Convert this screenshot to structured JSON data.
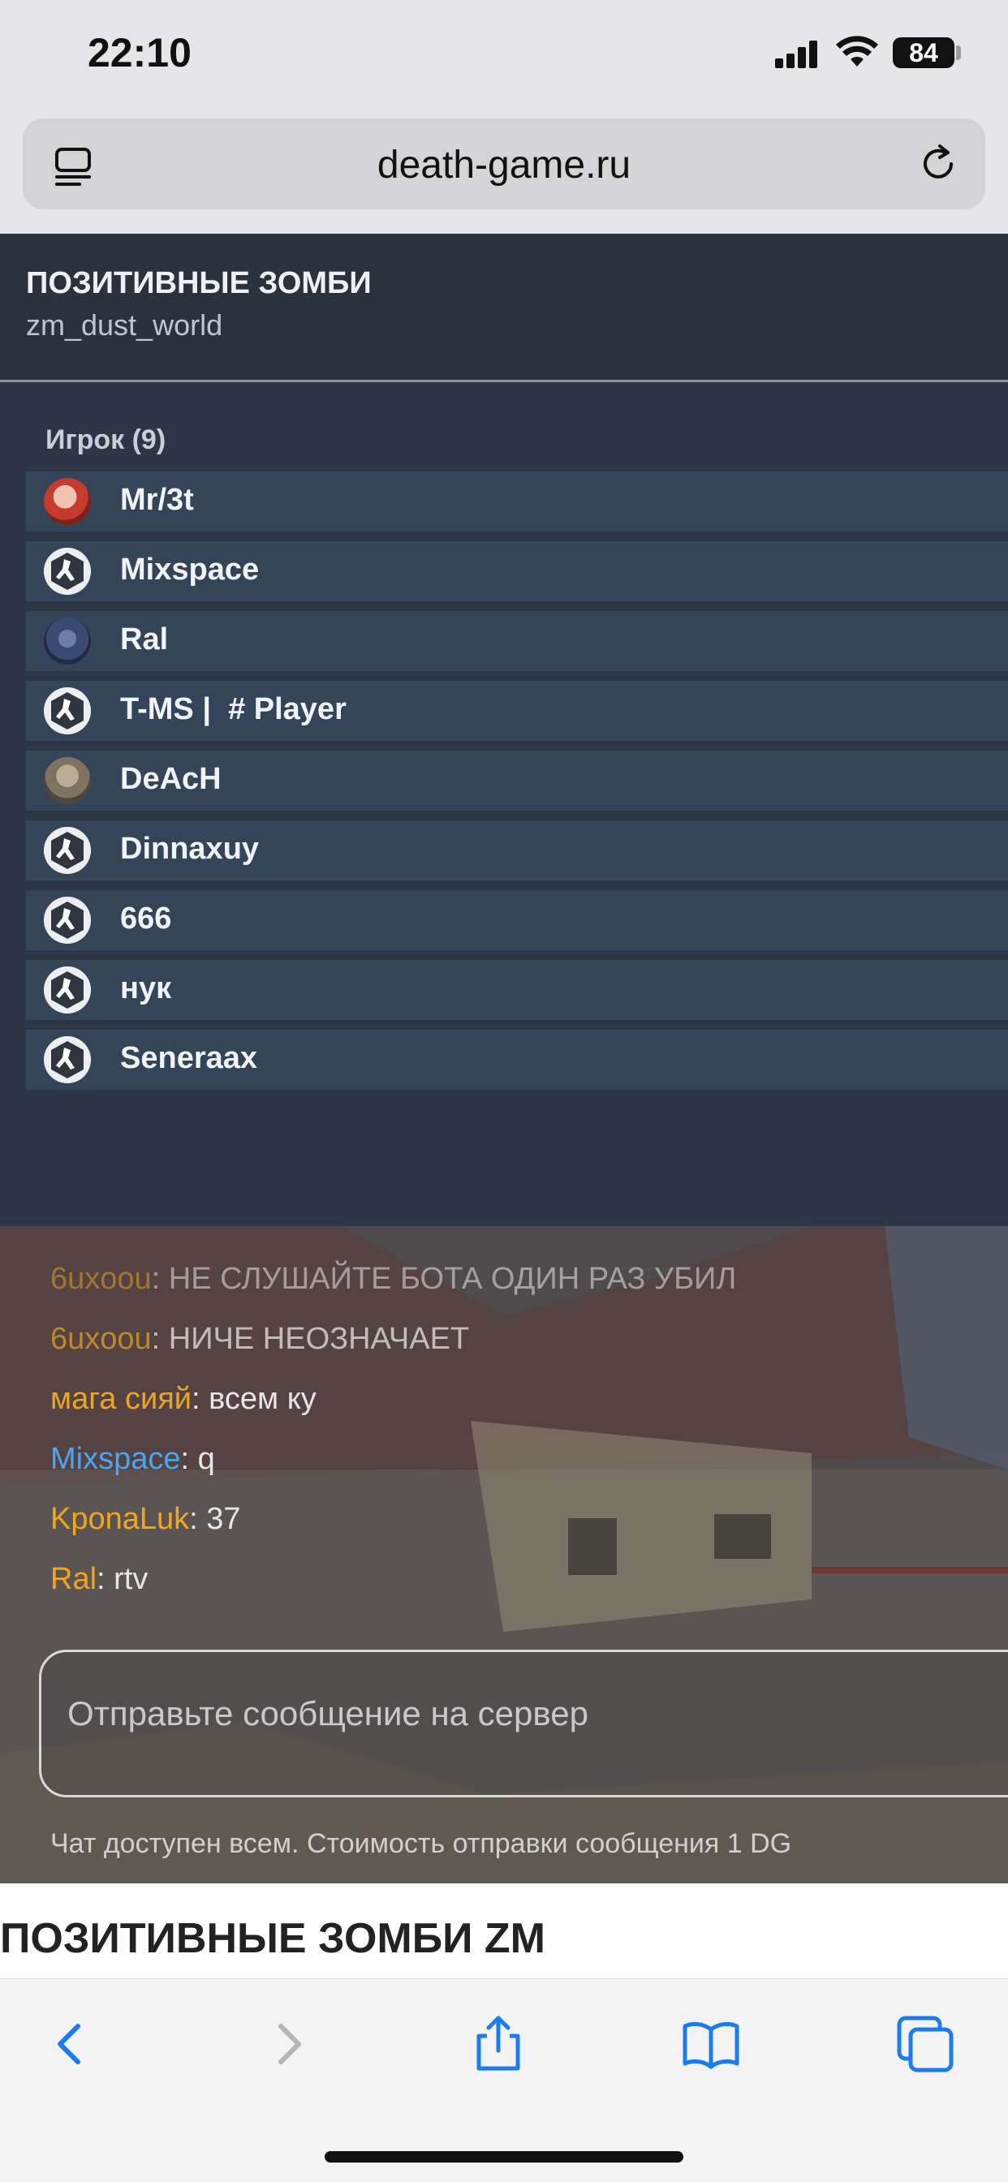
{
  "status_bar": {
    "time": "22:10",
    "battery": "84"
  },
  "browser": {
    "url": "death-game.ru"
  },
  "server": {
    "name": "ПОЗИТИВНЫЕ ЗОМБИ",
    "map": "zm_dust_world"
  },
  "players": {
    "title": "Игрок (9)",
    "items": [
      {
        "name": "Mr/3t",
        "avatar": "photo-avatar"
      },
      {
        "name": "Mixspace",
        "avatar": "cs-logo-avatar"
      },
      {
        "name": "Ral",
        "avatar": "photo-avatar"
      },
      {
        "name": "T-MS |  # Player",
        "avatar": "cs-logo-avatar"
      },
      {
        "name": "DeAcH",
        "avatar": "photo-avatar"
      },
      {
        "name": "Dinnaxuy",
        "avatar": "cs-logo-avatar"
      },
      {
        "name": "666",
        "avatar": "cs-logo-avatar"
      },
      {
        "name": "нук",
        "avatar": "cs-logo-avatar"
      },
      {
        "name": "Seneraax",
        "avatar": "cs-logo-avatar"
      }
    ]
  },
  "chat": {
    "messages": [
      {
        "nick": "6uxoou",
        "sep": ": ",
        "text": "НЕ СЛУШАЙТЕ БОТА ОДИН РАЗ УБИЛ",
        "color": "#e0a020"
      },
      {
        "nick": "6uxoou",
        "sep": ": ",
        "text": "НИЧЕ НЕОЗНАЧАЕТ",
        "color": "#e0a020"
      },
      {
        "nick": "мага сияй",
        "sep": ": ",
        "text": "всем ку",
        "color": "#e8a628"
      },
      {
        "nick": "Mixspace",
        "sep": ": ",
        "text": "q",
        "color": "#4aa6ee"
      },
      {
        "nick": "KponaLuk",
        "sep": ": ",
        "text": "37",
        "color": "#f2a51f"
      },
      {
        "nick": "Ral",
        "sep": ": ",
        "text": "rtv",
        "color": "#f2a51f"
      }
    ],
    "input_placeholder": "Отправьте сообщение на сервер",
    "note": "Чат доступен всем. Стоимость отправки сообщения 1 DG"
  },
  "below": {
    "title": "ПОЗИТИВНЫЕ ЗОМБИ ZM"
  },
  "toolbar": {
    "icons": [
      "back-icon",
      "forward-icon",
      "share-icon",
      "bookmarks-icon",
      "tabs-icon"
    ]
  }
}
